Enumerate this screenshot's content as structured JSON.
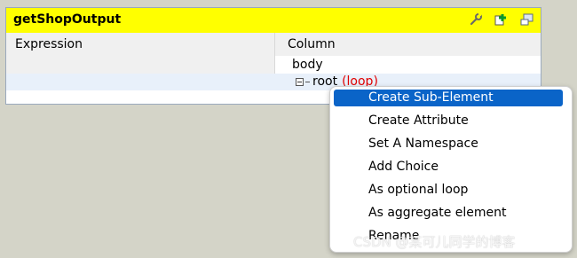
{
  "panel": {
    "title": "getShopOutput",
    "colors": {
      "title_bg": "#ffff00",
      "selected_row": "#e8f0fa",
      "menu_highlight": "#0a64c8",
      "loop_text": "#e00000"
    },
    "toolbar_icons": [
      "wrench-icon",
      "add-node-icon",
      "minimize-icon"
    ],
    "columns": {
      "expression": "Expression",
      "column": "Column"
    },
    "tree": {
      "body_label": "body",
      "root_label": "root",
      "root_tag": "(loop)"
    }
  },
  "context_menu": {
    "items": [
      {
        "label": "Create Sub-Element",
        "active": true
      },
      {
        "label": "Create Attribute",
        "active": false
      },
      {
        "label": "Set A Namespace",
        "active": false
      },
      {
        "label": "Add Choice",
        "active": false
      },
      {
        "label": "As optional loop",
        "active": false
      },
      {
        "label": "As aggregate element",
        "active": false
      },
      {
        "label": "Rename",
        "active": false
      }
    ]
  },
  "watermark": "CSDN @某可儿同学的博客"
}
